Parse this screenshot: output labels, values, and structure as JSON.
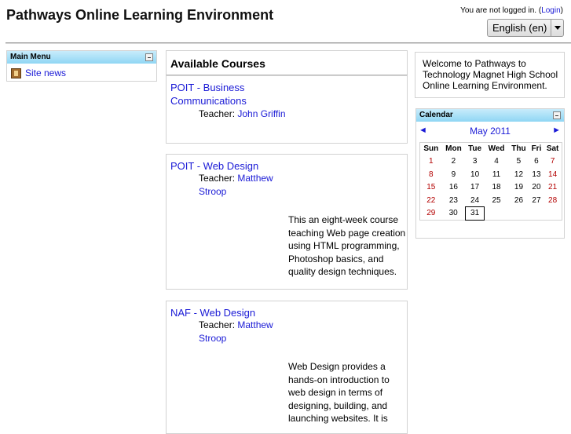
{
  "header": {
    "title": "Pathways Online Learning Environment",
    "login_prefix": "You are not logged in. (",
    "login_link": "Login",
    "login_suffix": ")",
    "language": "English (en)"
  },
  "main_menu": {
    "title": "Main Menu",
    "items": [
      {
        "label": "Site news",
        "icon": "news-icon"
      }
    ]
  },
  "courses": {
    "title": "Available Courses",
    "teacher_label": "Teacher:",
    "list": [
      {
        "name": "POIT - Business Communications",
        "teacher": "John Griffin",
        "summary": ""
      },
      {
        "name": "POIT - Web Design",
        "teacher": "Matthew Stroop",
        "summary": "This an eight-week course teaching Web page creation using HTML programming, Photoshop basics, and quality design techniques."
      },
      {
        "name": "NAF - Web Design",
        "teacher": "Matthew Stroop",
        "summary": "Web Design provides a hands-on introduction to web design in terms of designing, building, and launching websites.  It is"
      }
    ]
  },
  "welcome": {
    "text": "Welcome to Pathways to Technology Magnet High School Online Learning Environment."
  },
  "calendar": {
    "title": "Calendar",
    "month": "May 2011",
    "prev": "◄",
    "next": "►",
    "weekdays": [
      "Sun",
      "Mon",
      "Tue",
      "Wed",
      "Thu",
      "Fri",
      "Sat"
    ],
    "weeks": [
      [
        "1",
        "2",
        "3",
        "4",
        "5",
        "6",
        "7"
      ],
      [
        "8",
        "9",
        "10",
        "11",
        "12",
        "13",
        "14"
      ],
      [
        "15",
        "16",
        "17",
        "18",
        "19",
        "20",
        "21"
      ],
      [
        "22",
        "23",
        "24",
        "25",
        "26",
        "27",
        "28"
      ],
      [
        "29",
        "30",
        "31",
        "",
        "",
        "",
        ""
      ]
    ],
    "today": "31",
    "colors": {
      "weekend": "#b30000",
      "header_gradient_top": "#c8ecfb",
      "header_gradient_bottom": "#8fd6f4",
      "link": "#1a1ad6"
    }
  }
}
